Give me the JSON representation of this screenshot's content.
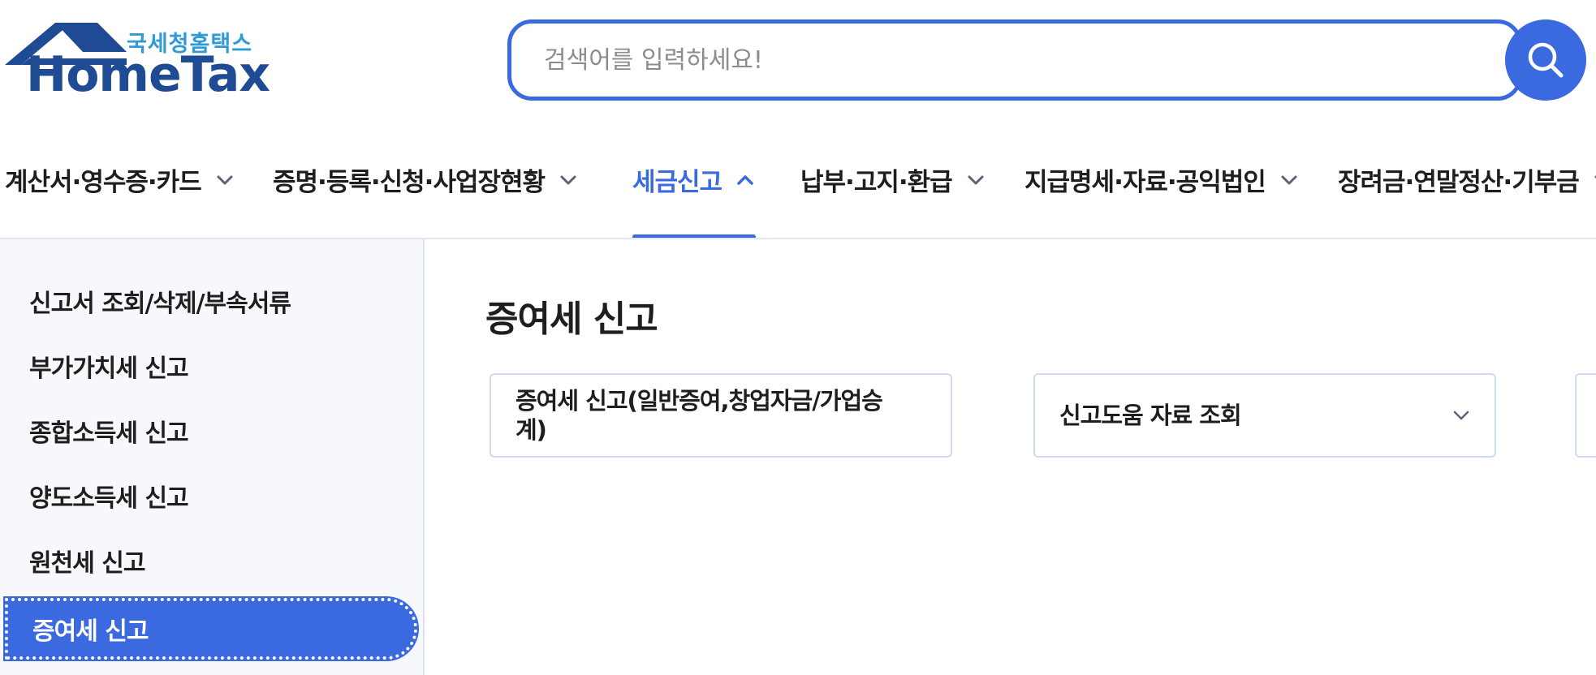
{
  "header": {
    "logo_sub": "국세청홈택스",
    "logo_main": "HomeTax",
    "search_placeholder": "검색어를 입력하세요!"
  },
  "gnb": {
    "items": [
      {
        "label": "계산서·영수증·카드",
        "active": false
      },
      {
        "label": "증명·등록·신청·사업장현황",
        "active": false
      },
      {
        "label": "세금신고",
        "active": true
      },
      {
        "label": "납부·고지·환급",
        "active": false
      },
      {
        "label": "지급명세·자료·공익법인",
        "active": false
      },
      {
        "label": "장려금·연말정산·기부금",
        "active": false
      }
    ]
  },
  "sidebar": {
    "items": [
      {
        "label": "신고서 조회/삭제/부속서류",
        "active": false
      },
      {
        "label": "부가가치세 신고",
        "active": false
      },
      {
        "label": "종합소득세 신고",
        "active": false
      },
      {
        "label": "양도소득세 신고",
        "active": false
      },
      {
        "label": "원천세 신고",
        "active": false
      },
      {
        "label": "증여세 신고",
        "active": true
      }
    ]
  },
  "main": {
    "title": "증여세 신고",
    "cards": [
      {
        "label": "증여세 신고(일반증여,창업자금/가업승계)"
      },
      {
        "label": "신고도움 자료 조회"
      }
    ]
  },
  "colors": {
    "accent": "#3a69e0",
    "logo_blue": "#1f4a94",
    "logo_sub": "#2f9ad3",
    "sidebar_bg": "#f6f8fc"
  }
}
